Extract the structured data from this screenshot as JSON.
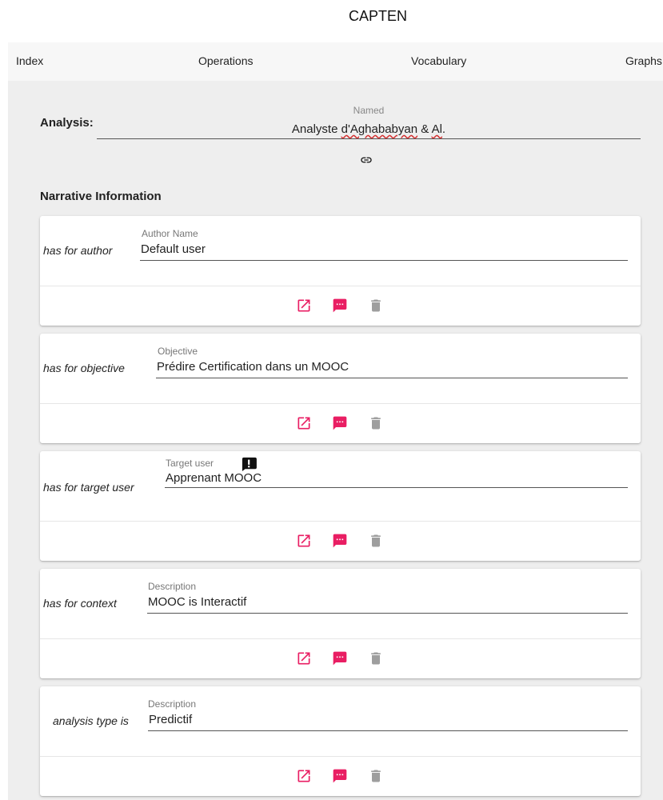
{
  "app": {
    "title": "CAPTEN"
  },
  "nav": {
    "items": [
      "Index",
      "Operations",
      "Vocabulary",
      "Graphs"
    ]
  },
  "analysis": {
    "label": "Analysis:",
    "field_label": "Named",
    "value_prefix": "Analyste ",
    "value_underlined_1": "d'Aghababyan",
    "value_middle": " & ",
    "value_underlined_2": "Al",
    "value_suffix": "."
  },
  "section": {
    "title": "Narrative Information"
  },
  "cards": [
    {
      "predicate": "has for author",
      "field_label": "Author Name",
      "value": "Default user",
      "alert": false
    },
    {
      "predicate": "has for objective",
      "field_label": "Objective",
      "value": "Prédire Certification dans un MOOC",
      "alert": false
    },
    {
      "predicate": "has for target user",
      "field_label": "Target user",
      "value": "Apprenant MOOC",
      "alert": true
    },
    {
      "predicate": "has for context",
      "field_label": "Description",
      "value": "MOOC is Interactif",
      "alert": false
    },
    {
      "predicate": "analysis type is",
      "field_label": "Description",
      "value": "Predictif",
      "alert": false
    }
  ],
  "icons": {
    "link": "link-icon",
    "open": "open-in-new-icon",
    "comment": "comment-icon",
    "delete": "delete-icon",
    "alert": "feedback-alert-icon"
  },
  "colors": {
    "accent": "#e91e63",
    "delete_gray": "#9e9e9e"
  }
}
